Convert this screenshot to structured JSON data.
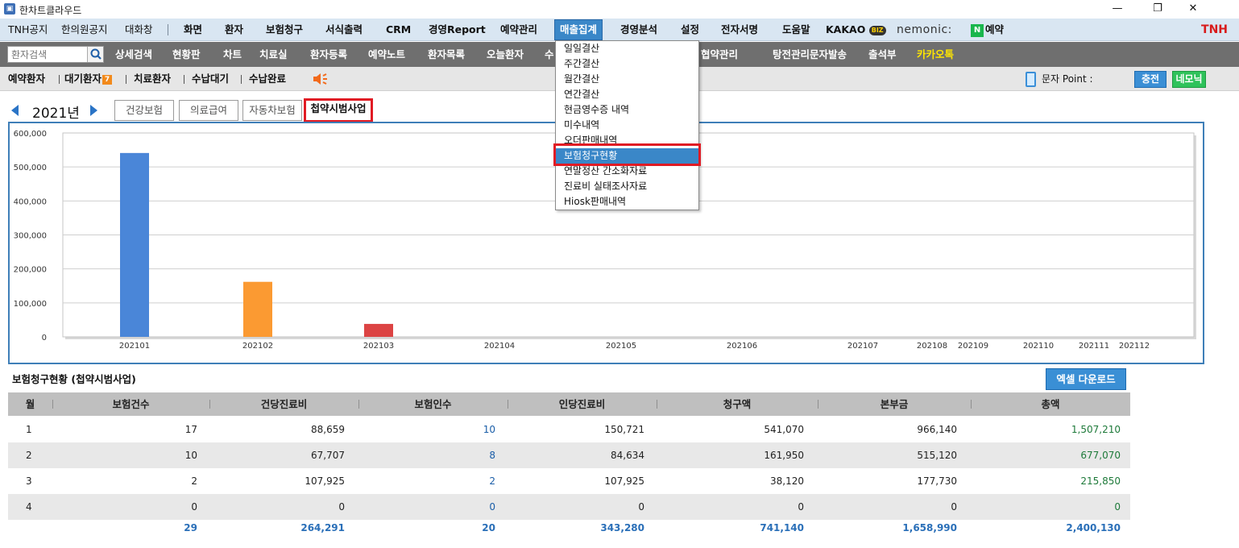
{
  "window": {
    "title": "한차트클라우드",
    "icon": "app-icon",
    "controls": [
      "—",
      "❐",
      "✕"
    ]
  },
  "menubar": {
    "left_items": [
      "TNH공지",
      "한의원공지",
      "대화창"
    ],
    "items": [
      "화면",
      "환자",
      "보험청구",
      "서식출력",
      "CRM",
      "경영Report",
      "예약관리",
      "매출집계",
      "경영분석",
      "설정",
      "전자서명",
      "도움말"
    ],
    "active": "매출집계",
    "kakao": "KAKAO",
    "kakao_badge": "BIZ",
    "nemonic": "nemonic:",
    "naver_badge": "N",
    "naver_label": "예약",
    "brand": "TNH"
  },
  "toolbar": {
    "search_placeholder": "환자검색",
    "items": [
      "상세검색",
      "현황판",
      "차트",
      "치료실",
      "환자등록",
      "예약노트",
      "환자목록",
      "오늘환자",
      "수",
      "협약관리",
      "탕전관리",
      "문자발송",
      "출석부",
      "카카오톡"
    ]
  },
  "statusbar": {
    "items": [
      "예약환자",
      "대기환자",
      "치료환자",
      "수납대기",
      "수납완료"
    ],
    "waiting_badge": "7",
    "sms_label": "문자 Point :",
    "charge_button": "충전",
    "nemonic_button": "네모닉"
  },
  "year_nav": {
    "year": "2021년"
  },
  "category_tabs": {
    "items": [
      "건강보험",
      "의료급여",
      "자동차보험",
      "첩약시범사업"
    ],
    "active": "첩약시범사업"
  },
  "dropdown": {
    "items": [
      "일일결산",
      "주간결산",
      "월간결산",
      "연간결산",
      "현금영수증 내역",
      "미수내역",
      "오더판매내역",
      "보험청구현황",
      "연말정산 간소화자료",
      "진료비 실태조사자료",
      "Hiosk판매내역"
    ],
    "selected": "보험청구현황"
  },
  "chart_data": {
    "type": "bar",
    "categories": [
      "202101",
      "202102",
      "202103",
      "202104",
      "202105",
      "202106",
      "202107",
      "202108",
      "202109",
      "202110",
      "202111",
      "202112"
    ],
    "values": [
      541070,
      161950,
      38120,
      0,
      0,
      0,
      0,
      0,
      0,
      0,
      0,
      0
    ],
    "bar_colors": [
      "#4a86d8",
      "#fb9a32",
      "#dc4444"
    ],
    "yticks": [
      "600,000",
      "500,000",
      "400,000",
      "300,000",
      "200,000",
      "100,000",
      "0"
    ],
    "ylim": [
      0,
      600000
    ],
    "grid": true
  },
  "section": {
    "title": "보험청구현황 (첩약시범사업)",
    "excel_button": "엑셀 다운로드"
  },
  "table": {
    "headers": [
      "월",
      "보험건수",
      "건당진료비",
      "보험인수",
      "인당진료비",
      "청구액",
      "본부금",
      "총액"
    ],
    "rows": [
      [
        "1",
        "17",
        "88,659",
        "10",
        "150,721",
        "541,070",
        "966,140",
        "1,507,210"
      ],
      [
        "2",
        "10",
        "67,707",
        "8",
        "84,634",
        "161,950",
        "515,120",
        "677,070"
      ],
      [
        "3",
        "2",
        "107,925",
        "2",
        "107,925",
        "38,120",
        "177,730",
        "215,850"
      ],
      [
        "4",
        "0",
        "0",
        "0",
        "0",
        "0",
        "0",
        "0"
      ]
    ],
    "totals": [
      "",
      "29",
      "264,291",
      "20",
      "343,280",
      "741,140",
      "1,658,990",
      "2,400,130"
    ]
  }
}
